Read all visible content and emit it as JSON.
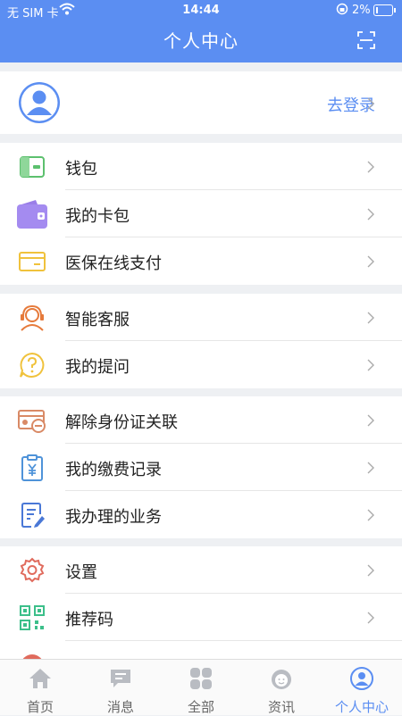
{
  "status_bar": {
    "carrier": "无 SIM 卡",
    "time": "14:44",
    "battery": "2%"
  },
  "header": {
    "title": "个人中心",
    "scan_icon": "scan-icon"
  },
  "profile": {
    "login_label": "去登录"
  },
  "groups": [
    [
      {
        "label": "钱包",
        "icon": "wallet-icon"
      },
      {
        "label": "我的卡包",
        "icon": "card-wallet-icon"
      },
      {
        "label": "医保在线支付",
        "icon": "card-icon"
      }
    ],
    [
      {
        "label": "智能客服",
        "icon": "customer-service-icon"
      },
      {
        "label": "我的提问",
        "icon": "question-icon"
      }
    ],
    [
      {
        "label": "解除身份证关联",
        "icon": "id-card-unlink-icon"
      },
      {
        "label": "我的缴费记录",
        "icon": "payment-record-icon"
      },
      {
        "label": "我办理的业务",
        "icon": "business-icon"
      }
    ],
    [
      {
        "label": "设置",
        "icon": "settings-icon"
      },
      {
        "label": "推荐码",
        "icon": "qr-code-icon"
      }
    ]
  ],
  "tabs": [
    {
      "label": "首页",
      "icon": "home-icon"
    },
    {
      "label": "消息",
      "icon": "message-icon"
    },
    {
      "label": "全部",
      "icon": "grid-icon"
    },
    {
      "label": "资讯",
      "icon": "news-icon"
    },
    {
      "label": "个人中心",
      "icon": "user-icon",
      "active": true
    }
  ],
  "colors": {
    "accent": "#5b8ef2",
    "background": "#eef0f3"
  }
}
